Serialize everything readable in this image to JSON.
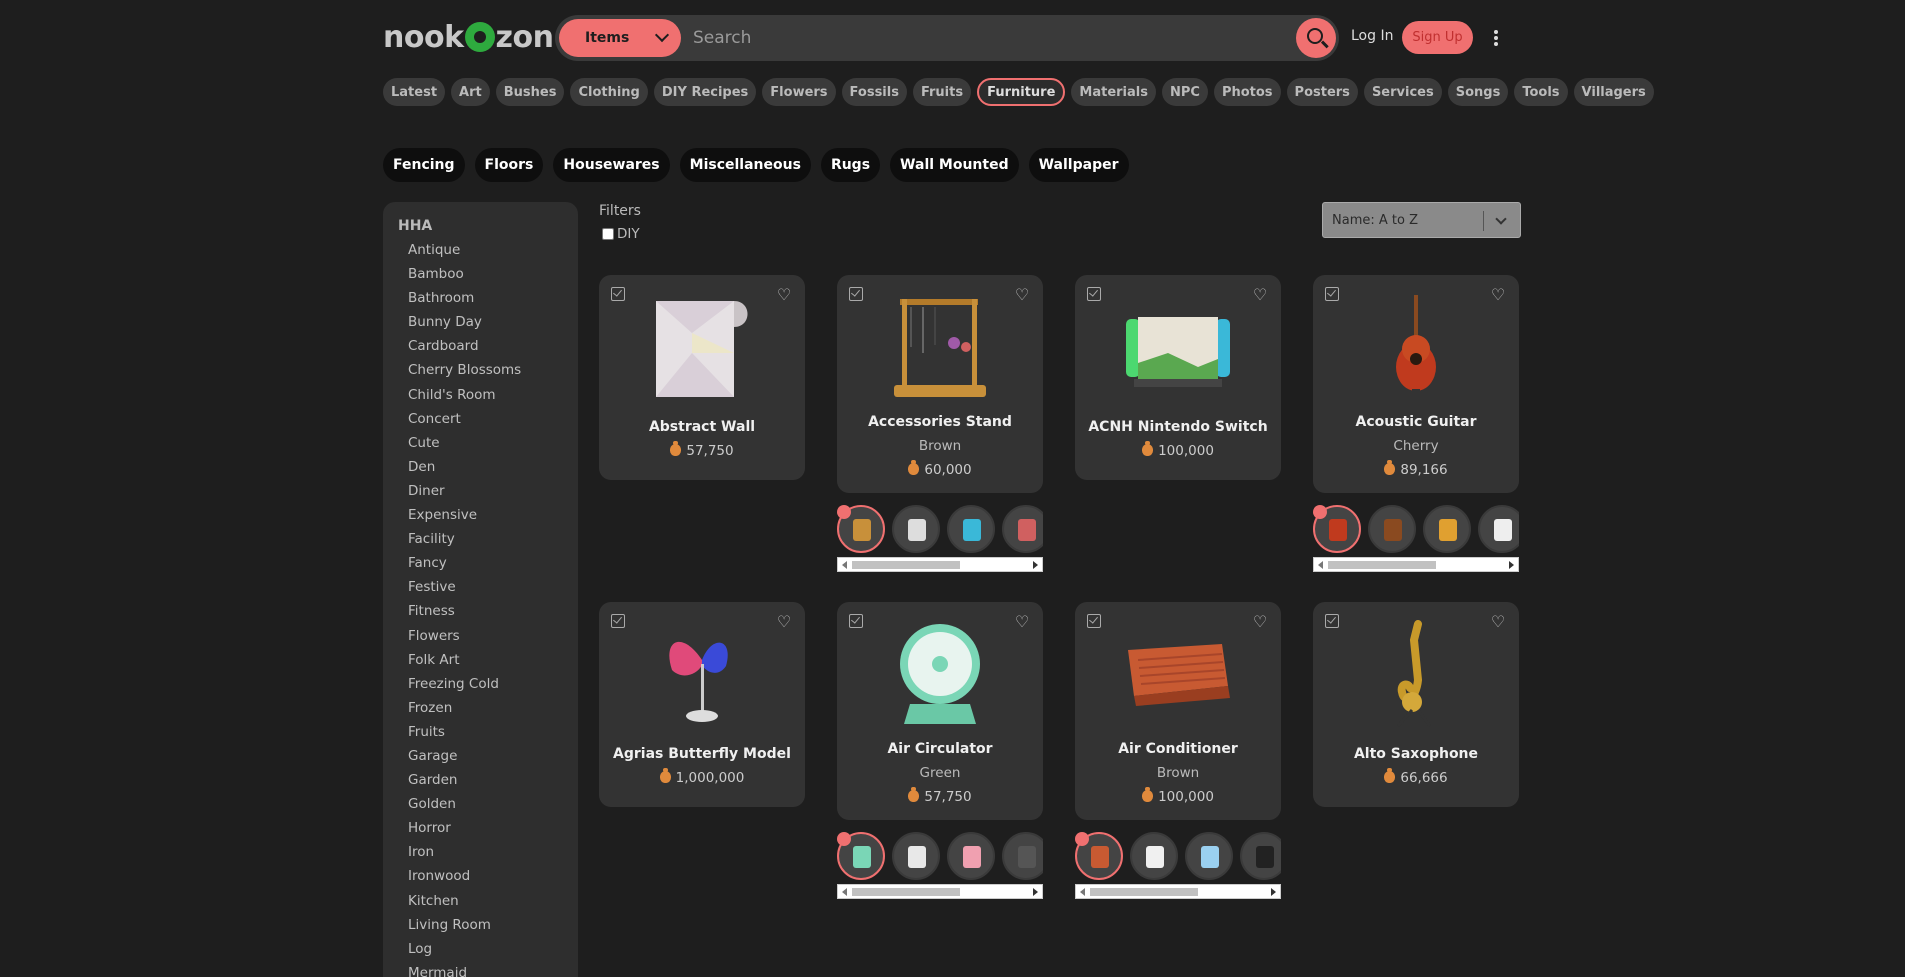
{
  "header": {
    "logo_left": "nook",
    "logo_right": "zon",
    "category_label": "Items",
    "search_placeholder": "Search",
    "login_label": "Log In",
    "signup_label": "Sign Up"
  },
  "categories": [
    "Latest",
    "Art",
    "Bushes",
    "Clothing",
    "DIY Recipes",
    "Flowers",
    "Fossils",
    "Fruits",
    "Furniture",
    "Materials",
    "NPC",
    "Photos",
    "Posters",
    "Services",
    "Songs",
    "Tools",
    "Villagers"
  ],
  "active_category": "Furniture",
  "subcategories": [
    "Fencing",
    "Floors",
    "Housewares",
    "Miscellaneous",
    "Rugs",
    "Wall Mounted",
    "Wallpaper"
  ],
  "sidebar": {
    "heading": "HHA",
    "items": [
      "Antique",
      "Bamboo",
      "Bathroom",
      "Bunny Day",
      "Cardboard",
      "Cherry Blossoms",
      "Child's Room",
      "Concert",
      "Cute",
      "Den",
      "Diner",
      "Expensive",
      "Facility",
      "Fancy",
      "Festive",
      "Fitness",
      "Flowers",
      "Folk Art",
      "Freezing Cold",
      "Frozen",
      "Fruits",
      "Garage",
      "Garden",
      "Golden",
      "Horror",
      "Iron",
      "Ironwood",
      "Kitchen",
      "Living Room",
      "Log",
      "Mermaid"
    ]
  },
  "filters": {
    "label": "Filters",
    "diy_label": "DIY"
  },
  "sort": {
    "selected": "Name: A to Z"
  },
  "items": [
    {
      "name": "Abstract Wall",
      "variant": "",
      "price": "57,750"
    },
    {
      "name": "Accessories Stand",
      "variant": "Brown",
      "price": "60,000"
    },
    {
      "name": "ACNH Nintendo Switch",
      "variant": "",
      "price": "100,000"
    },
    {
      "name": "Acoustic Guitar",
      "variant": "Cherry",
      "price": "89,166"
    },
    {
      "name": "Agrias Butterfly Model",
      "variant": "",
      "price": "1,000,000"
    },
    {
      "name": "Air Circulator",
      "variant": "Green",
      "price": "57,750"
    },
    {
      "name": "Air Conditioner",
      "variant": "Brown",
      "price": "100,000"
    },
    {
      "name": "Alto Saxophone",
      "variant": "",
      "price": "66,666"
    }
  ],
  "colors": {
    "accent": "#f07070",
    "background": "#1e1e1e",
    "card": "#333333"
  }
}
